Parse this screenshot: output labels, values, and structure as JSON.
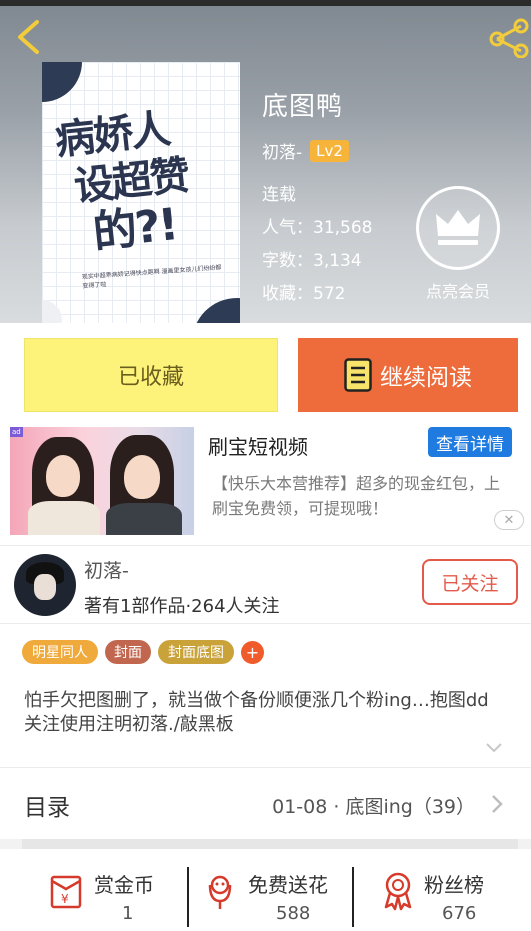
{
  "header": {
    "book_title": "底图鸭",
    "author": "初落-",
    "level": "Lv2",
    "status": "连载",
    "popularity": "人气：31,568",
    "word_count": "字数：3,134",
    "favorites": "收藏：572",
    "member_label": "点亮会员"
  },
  "cover": {
    "title_line1": "病娇人",
    "title_line2": "设超赞",
    "title_line3": "的?!",
    "blurb": "现实中超乖病娇记得快点跑啊 漫画里女孩儿们纷纷都变得了啦"
  },
  "actions": {
    "favorited_label": "已收藏",
    "read_label": "继续阅读"
  },
  "ad": {
    "tag": "ad",
    "title": "刷宝短视频",
    "button": "查看详情",
    "description": "【快乐大本营推荐】超多的现金红包，上刷宝免费领，可提现哦！",
    "close": "✕"
  },
  "author_card": {
    "name": "初落-",
    "info": "著有1部作品·264人关注",
    "follow_label": "已关注"
  },
  "tags": [
    {
      "label": "明星同人",
      "color": "#f0a93b"
    },
    {
      "label": "封面",
      "color": "#c2674f"
    },
    {
      "label": "封面底图",
      "color": "#c9a23a"
    }
  ],
  "tag_add": "+",
  "description": "怕手欠把图删了，就当做个备份顺便涨几个粉ing…抱图dd关注使用注明初落./敲黑板",
  "toc": {
    "title": "目录",
    "latest": "01-08 · 底图ing（39）"
  },
  "bottom_bar": {
    "items": [
      {
        "label": "赏金币",
        "count": "1",
        "icon": "red-envelope-icon"
      },
      {
        "label": "免费送花",
        "count": "588",
        "icon": "flower-icon"
      },
      {
        "label": "粉丝榜",
        "count": "676",
        "icon": "medal-icon"
      }
    ]
  },
  "colors": {
    "accent_orange": "#ee6b3b",
    "favorite_yellow": "#fdf27a",
    "follow_red": "#e45a4a",
    "ad_blue": "#1f7be0",
    "level_badge": "#f6b53a",
    "icon_red": "#d63a2a"
  }
}
